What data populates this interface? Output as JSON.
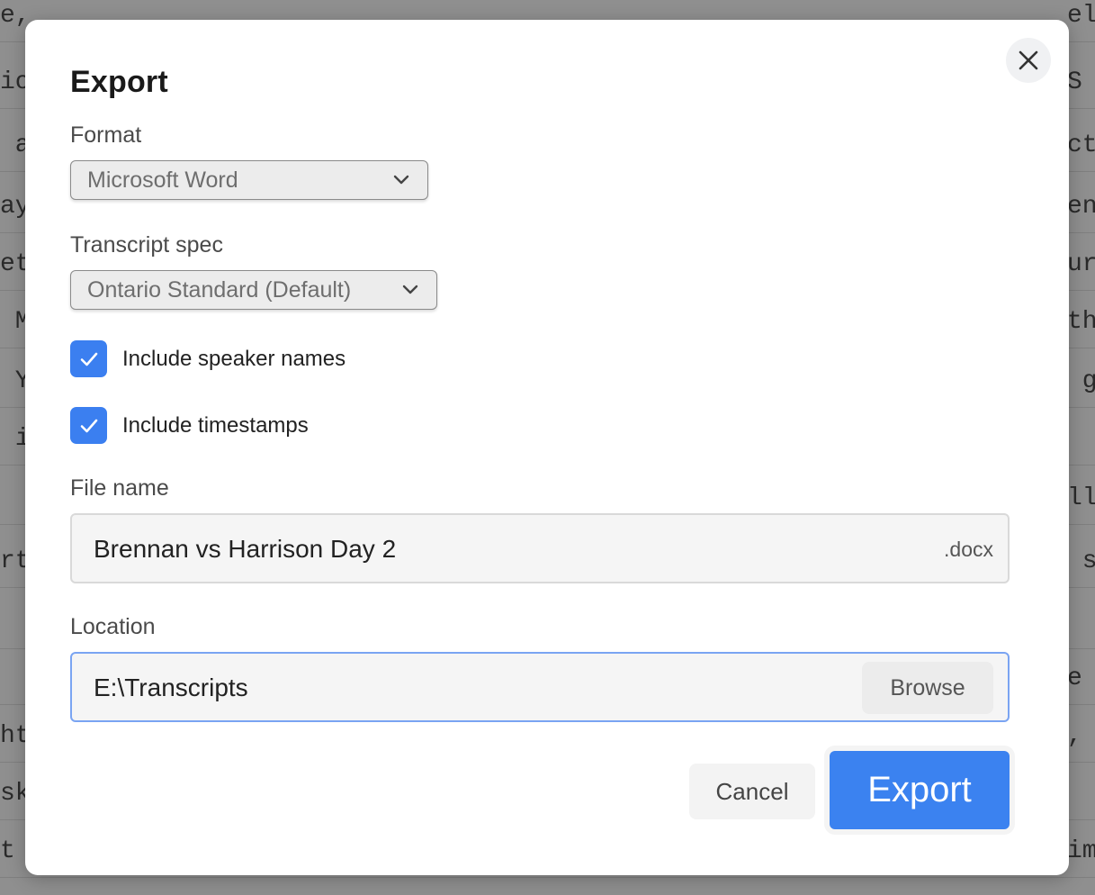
{
  "background_document": {
    "lines": [
      {
        "left": "e,",
        "right": "el"
      },
      {
        "left": "io",
        "right": "S"
      },
      {
        "left": " a",
        "right": "ct"
      },
      {
        "left": "ay",
        "right": "en"
      },
      {
        "left": "et",
        "right": "ur"
      },
      {
        "left": " M",
        "right": "th"
      },
      {
        "left": " Y",
        "right": " g"
      },
      {
        "left": " i",
        "right": ""
      },
      {
        "left": " ",
        "right": "ll"
      },
      {
        "left": "rt",
        "right": " s"
      },
      {
        "left": "",
        "right": ""
      },
      {
        "left": " ",
        "right": "e"
      },
      {
        "left": "ht",
        "right": ","
      },
      {
        "left": "sk",
        "right": ""
      },
      {
        "left": "t",
        "right": "im"
      }
    ]
  },
  "dialog": {
    "title": "Export",
    "close_icon": "close-icon",
    "format": {
      "label": "Format",
      "selected": "Microsoft Word"
    },
    "transcript_spec": {
      "label": "Transcript spec",
      "selected": "Ontario Standard (Default)"
    },
    "options": {
      "speaker_names": {
        "label": "Include speaker names",
        "checked": true
      },
      "timestamps": {
        "label": "Include timestamps",
        "checked": true
      }
    },
    "file_name": {
      "label": "File name",
      "value": "Brennan vs Harrison Day 2",
      "extension": ".docx"
    },
    "location": {
      "label": "Location",
      "value": "E:\\Transcripts",
      "browse_label": "Browse"
    },
    "cancel_label": "Cancel",
    "export_label": "Export"
  },
  "colors": {
    "accent": "#3b82f0",
    "overlay": "#8f8f8f"
  }
}
